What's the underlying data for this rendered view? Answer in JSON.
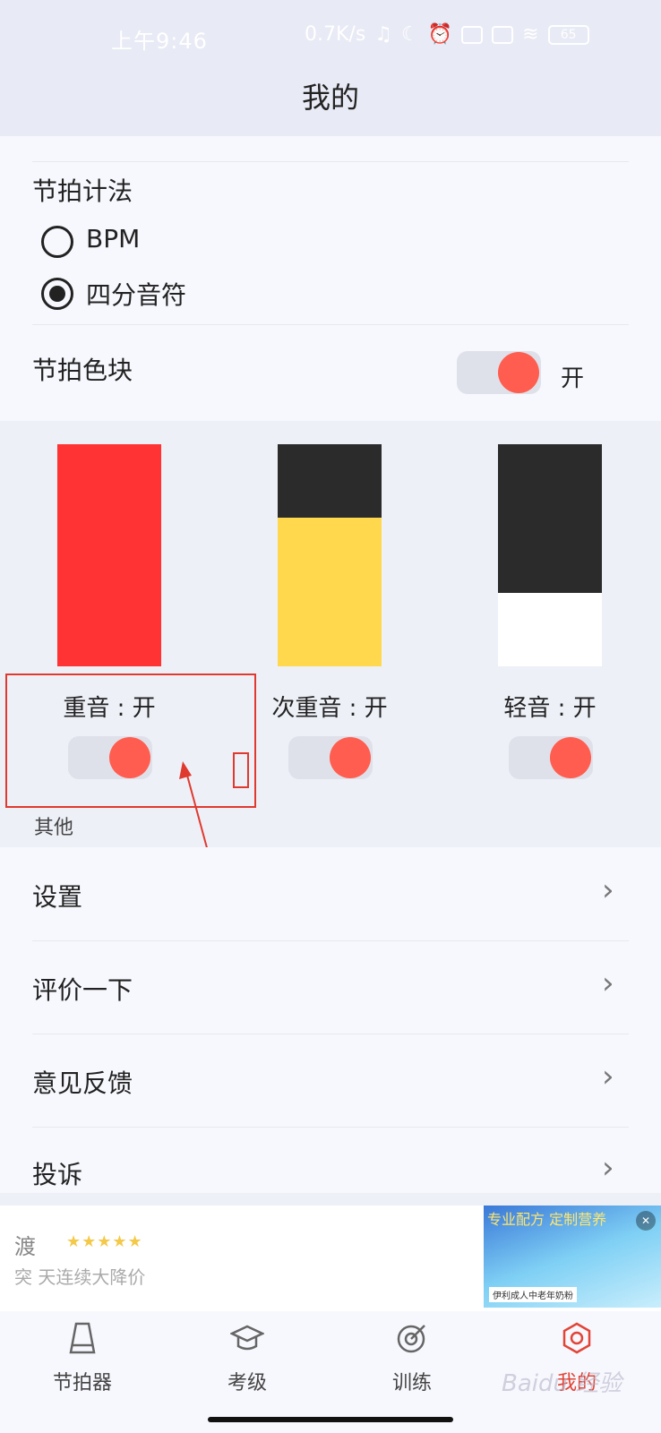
{
  "status_bar": {
    "time": "上午9:46",
    "speed": "0.7K/s",
    "battery": "65"
  },
  "header": {
    "title": "我的"
  },
  "settings": {
    "beat_notation": {
      "label": "节拍计法",
      "options": [
        {
          "label": "BPM",
          "selected": false
        },
        {
          "label": "四分音符",
          "selected": true
        }
      ]
    },
    "beat_color_block": {
      "label": "节拍色块",
      "state": "开",
      "on": true
    }
  },
  "beats": [
    {
      "label": "重音 : 开",
      "top_color": "#ff3333",
      "bottom_color": "#ff3333",
      "top_fraction": 1.0,
      "on": true
    },
    {
      "label": "次重音 : 开",
      "top_color": "#2b2b2b",
      "bottom_color": "#ffd84d",
      "top_fraction": 0.33,
      "on": true
    },
    {
      "label": "轻音 : 开",
      "top_color": "#2b2b2b",
      "bottom_color": "#ffffff",
      "top_fraction": 0.67,
      "on": true
    }
  ],
  "other": {
    "title": "其他",
    "items": [
      "设置",
      "评价一下",
      "意见反馈",
      "投诉"
    ]
  },
  "ad": {
    "title": "渡",
    "stars": "★★★★★",
    "desc": "突                                  天连续大降价",
    "image_text": "专业配方  定制营养",
    "image_caption": "伊利成人中老年奶粉"
  },
  "tabs": [
    {
      "label": "节拍器",
      "icon": "metronome-icon",
      "active": false
    },
    {
      "label": "考级",
      "icon": "graduation-cap-icon",
      "active": false
    },
    {
      "label": "训练",
      "icon": "target-icon",
      "active": false
    },
    {
      "label": "我的",
      "icon": "profile-ring-icon",
      "active": true
    }
  ],
  "colors": {
    "accent": "#ff5d4f",
    "active_tab": "#e24437",
    "annotation": "#e03a2e"
  },
  "watermark": "Baidu 经验"
}
